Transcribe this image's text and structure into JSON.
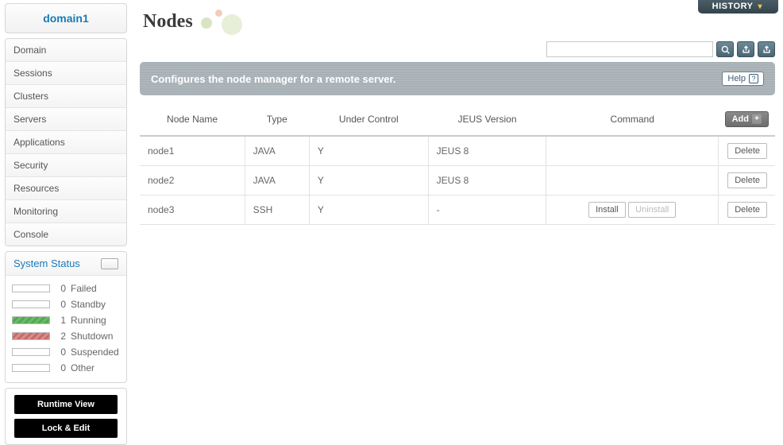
{
  "sidebar": {
    "domain_title": "domain1",
    "items": [
      "Domain",
      "Sessions",
      "Clusters",
      "Servers",
      "Applications",
      "Security",
      "Resources",
      "Monitoring",
      "Console"
    ]
  },
  "system_status": {
    "title": "System Status",
    "rows": [
      {
        "count": 0,
        "label": "Failed",
        "color": "none"
      },
      {
        "count": 0,
        "label": "Standby",
        "color": "none"
      },
      {
        "count": 1,
        "label": "Running",
        "color": "green"
      },
      {
        "count": 2,
        "label": "Shutdown",
        "color": "red"
      },
      {
        "count": 0,
        "label": "Suspended",
        "color": "none"
      },
      {
        "count": 0,
        "label": "Other",
        "color": "none"
      }
    ]
  },
  "action_buttons": {
    "runtime": "Runtime View",
    "lock_edit": "Lock & Edit"
  },
  "header": {
    "history_label": "HISTORY",
    "page_title": "Nodes"
  },
  "search": {
    "placeholder": ""
  },
  "desc_bar": {
    "text": "Configures the node manager for a remote server.",
    "help": "Help"
  },
  "table": {
    "columns": [
      "Node Name",
      "Type",
      "Under Control",
      "JEUS Version",
      "Command"
    ],
    "add_label": "Add",
    "delete_label": "Delete",
    "install_label": "Install",
    "uninstall_label": "Uninstall",
    "rows": [
      {
        "name": "node1",
        "type": "JAVA",
        "under": "Y",
        "version": "JEUS 8",
        "cmd": null
      },
      {
        "name": "node2",
        "type": "JAVA",
        "under": "Y",
        "version": "JEUS 8",
        "cmd": null
      },
      {
        "name": "node3",
        "type": "SSH",
        "under": "Y",
        "version": "-",
        "cmd": "install"
      }
    ]
  }
}
